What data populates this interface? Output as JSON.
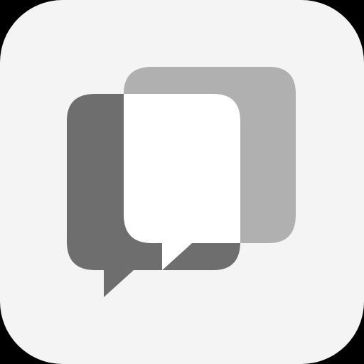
{
  "app_icon": {
    "icon": "chat-bubbles-icon",
    "colors": {
      "outer_background": "#000000",
      "tile_background": "#f4f4f4",
      "bubble_back": "#b0b0b0",
      "bubble_front_left": "#6e6e6e",
      "bubble_front_right": "#ffffff"
    }
  }
}
